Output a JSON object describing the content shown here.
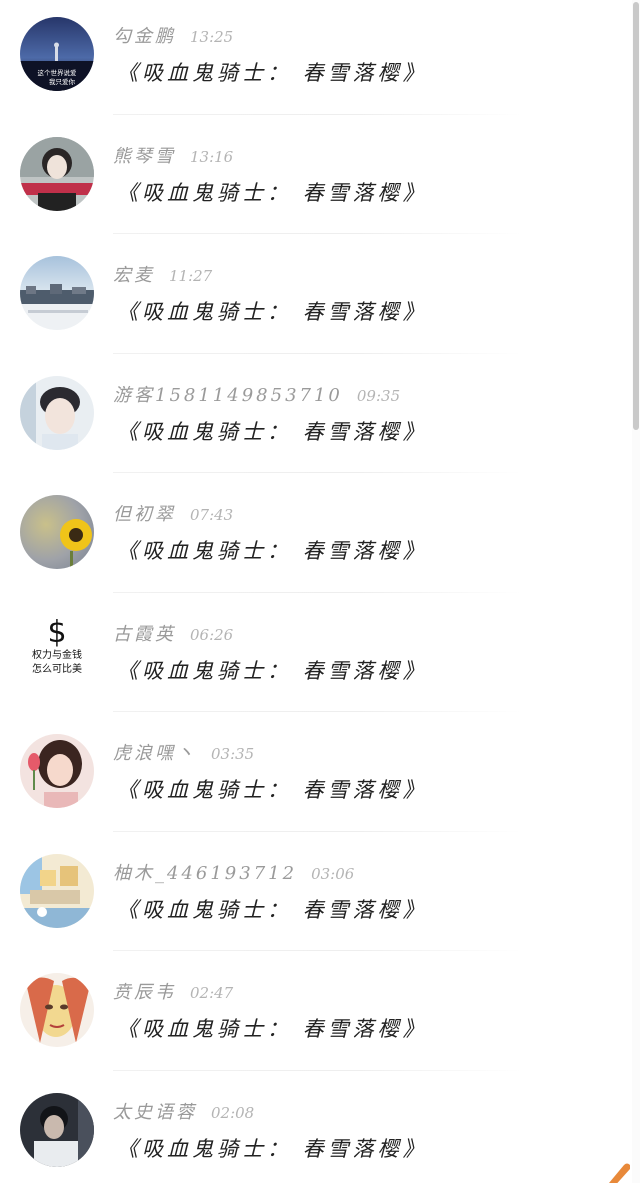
{
  "comments": [
    {
      "username": "勾金鹏",
      "time": "13:25",
      "message": "《吸血鬼骑士： 春雪落樱》",
      "avatar": {
        "icon": "night-coast-avatar",
        "lines": [
          "这个世界说爱",
          "我只爱你"
        ]
      }
    },
    {
      "username": "熊琴雪",
      "time": "13:16",
      "message": "《吸血鬼骑士： 春雪落樱》",
      "avatar": {
        "icon": "girl-portrait-avatar"
      }
    },
    {
      "username": "宏麦",
      "time": "11:27",
      "message": "《吸血鬼骑士： 春雪落樱》",
      "avatar": {
        "icon": "snowy-landscape-avatar"
      }
    },
    {
      "username": "游客1581149853710",
      "time": "09:35",
      "message": "《吸血鬼骑士： 春雪落樱》",
      "avatar": {
        "icon": "boy-portrait-avatar"
      }
    },
    {
      "username": "但初翠",
      "time": "07:43",
      "message": "《吸血鬼骑士： 春雪落樱》",
      "avatar": {
        "icon": "sunflower-avatar"
      }
    },
    {
      "username": "古霞英",
      "time": "06:26",
      "message": "《吸血鬼骑士： 春雪落樱》",
      "avatar": {
        "icon": "dollar-text-avatar",
        "symbol": "$",
        "lines": [
          "权力与金钱",
          "怎么可比美"
        ]
      }
    },
    {
      "username": "虎浪嘿丶",
      "time": "03:35",
      "message": "《吸血鬼骑士： 春雪落樱》",
      "avatar": {
        "icon": "anime-girl-tulip-avatar"
      }
    },
    {
      "username": "柚木_446193712",
      "time": "03:06",
      "message": "《吸血鬼骑士： 春雪落樱》",
      "avatar": {
        "icon": "cartoon-town-avatar"
      }
    },
    {
      "username": "贲辰韦",
      "time": "02:47",
      "message": "《吸血鬼骑士： 春雪落樱》",
      "avatar": {
        "icon": "sketch-face-avatar"
      }
    },
    {
      "username": "太史语蓉",
      "time": "02:08",
      "message": "《吸血鬼骑士： 春雪落樱》",
      "avatar": {
        "icon": "dark-photo-avatar"
      }
    }
  ],
  "colors": {
    "username": "#9a9a9a",
    "time": "#b4b4b4",
    "message": "#222222",
    "accent": "#e8893a"
  }
}
